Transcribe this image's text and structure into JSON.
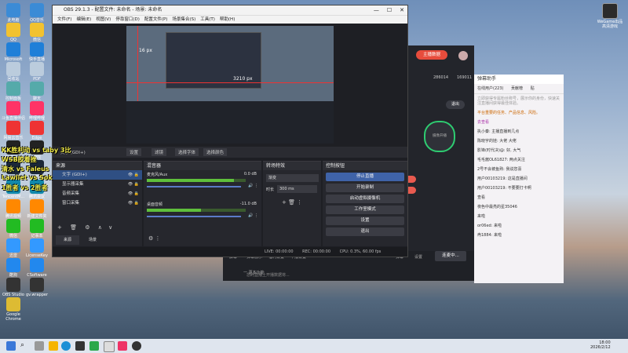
{
  "obs": {
    "title": "OBS 29.1.3 - 配置文件: 未命名 - 场景: 未命名",
    "menu": [
      "文件(F)",
      "编辑(E)",
      "视图(V)",
      "停靠窗口(D)",
      "配置文件(P)",
      "场景集合(S)",
      "工具(T)",
      "帮助(H)"
    ],
    "preview_label_left": "16 px",
    "preview_label_center": "3210 px",
    "source_bar": {
      "source": "文字 (GDI+)",
      "buttons": [
        "设置",
        "滤镜",
        "选择字体",
        "选择颜色"
      ]
    },
    "docks": {
      "scenes": {
        "title": "来源",
        "footer_tabs": [
          "来源",
          "场景"
        ]
      },
      "sources": {
        "items": [
          "文字 (GDI+)",
          "显示器采集",
          "音频采集",
          "窗口采集"
        ]
      },
      "mixer": {
        "title": "混音器",
        "channels": [
          {
            "name": "麦克风/Aux",
            "db": "0.0 dB",
            "level": 0.88
          },
          {
            "name": "桌面音频",
            "db": "-11.0 dB",
            "level": 0.55
          }
        ]
      },
      "transitions": {
        "title": "转场特效",
        "type": "渐变",
        "duration_label": "时长",
        "duration": "300 ms"
      },
      "controls": {
        "title": "控制按钮",
        "buttons": [
          "停止直播",
          "开始录制",
          "启动虚拟摄像机",
          "工作室模式",
          "设置",
          "退出"
        ]
      }
    },
    "status": {
      "live": "LIVE: 00:00:00",
      "rec": "REC: 00:00:00",
      "cpu": "CPU: 0.3%, 60.00 fps"
    }
  },
  "live_app": {
    "badge": "主播数据",
    "stats": [
      "286014",
      "169011"
    ],
    "exit_label": "退出",
    "camera_hint": "摄像开播",
    "bottom_bar": [
      "弹幕",
      "设置",
      "连麦中..."
    ],
    "bottom_tools": [
      "屏幕",
      "弹幕展示",
      "福利设置",
      "下播设置"
    ],
    "hint": "您的直播上开播数据将...",
    "more": "一 更多功能"
  },
  "chat": {
    "header": "弹幕助手",
    "tabs": [
      "在线用户(223)",
      "贡献榜",
      "贴"
    ],
    "tip": "立即获得专属粉丝称号，展示你的身份，快速关注直播间获得最佳体验。",
    "notice": "平台重要的任务、产品信息、风险。",
    "vip": "去查看",
    "messages": [
      "执小秦: 主播直播到几点",
      "陈晓宇的娃: 大佬 大佬",
      "影锋(时代决)@: 好, 大气",
      "毛毛酱OL61827: 两点关注",
      "2号不会被鱼熟: 我说您喜",
      "用户00103219: 这是直播间",
      "用户00103219: 不要要打卡啊",
      "查看",
      "夜色中最亮的星35046",
      "来啦",
      "or06ed: 来啦",
      "冉1884: 来啦"
    ]
  },
  "desktop": {
    "icons_left": [
      "此电脑",
      "QQ",
      "Microsoft Edge",
      "回收站",
      "控制面板",
      "斗鱼直播伴侣",
      "网易云音乐",
      "WeGame",
      "Steam",
      "TencentM...",
      "腾讯视频",
      "微信",
      "迅雷",
      "酷狗",
      "OBS Studio",
      "Google Chrome"
    ],
    "icons_col2": [
      "QQ音乐",
      "微信",
      "快手直播",
      "PDF",
      "聊天",
      "哔哩哔哩",
      "Edge",
      "游戏",
      "QQ",
      "腾讯会议",
      "新建文件夹",
      "记事本",
      "LicenseKey",
      "CSoftware",
      "gv.wrapper"
    ],
    "overlay_lines": [
      "KK胜利动 vs taby 3比",
      "WSB胶着挫",
      "清水 vs Faleus",
      "Lawliet vs Sok",
      "1胜者 vs 2胜者"
    ],
    "corner_app": "WeGame出品\n高清游戏"
  },
  "taskbar": {
    "time": "18:00",
    "date": "2026/2/12"
  }
}
